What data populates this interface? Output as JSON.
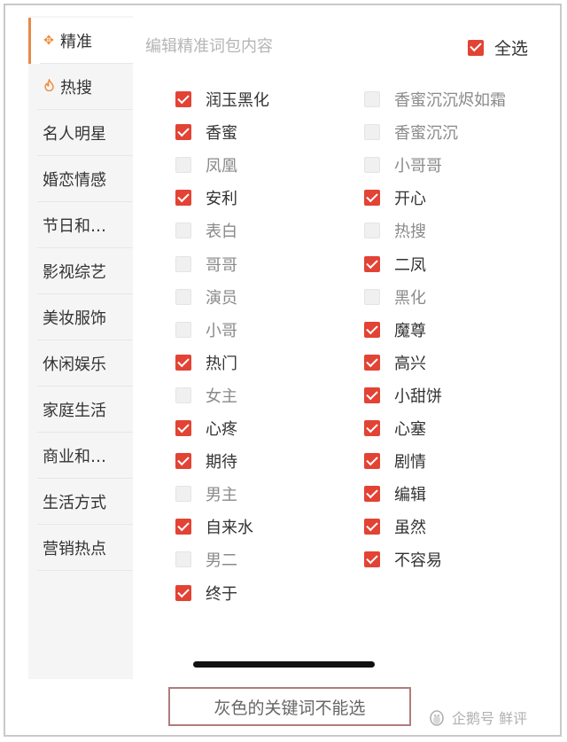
{
  "sidebar": {
    "items": [
      {
        "label": "精准",
        "icon": "target-icon",
        "active": true
      },
      {
        "label": "热搜",
        "icon": "flame-icon",
        "active": false
      },
      {
        "label": "名人明星",
        "active": false
      },
      {
        "label": "婚恋情感",
        "active": false
      },
      {
        "label": "节日和…",
        "active": false
      },
      {
        "label": "影视综艺",
        "active": false
      },
      {
        "label": "美妆服饰",
        "active": false
      },
      {
        "label": "休闲娱乐",
        "active": false
      },
      {
        "label": "家庭生活",
        "active": false
      },
      {
        "label": "商业和…",
        "active": false
      },
      {
        "label": "生活方式",
        "active": false
      },
      {
        "label": "营销热点",
        "active": false
      }
    ]
  },
  "header": {
    "label": "编辑精准词包内容",
    "select_all_label": "全选",
    "select_all_checked": true
  },
  "keywords": {
    "left": [
      {
        "label": "润玉黑化",
        "checked": true
      },
      {
        "label": "香蜜",
        "checked": true
      },
      {
        "label": "凤凰",
        "checked": false
      },
      {
        "label": "安利",
        "checked": true
      },
      {
        "label": "表白",
        "checked": false
      },
      {
        "label": "哥哥",
        "checked": false
      },
      {
        "label": "演员",
        "checked": false
      },
      {
        "label": "小哥",
        "checked": false
      },
      {
        "label": "热门",
        "checked": true
      },
      {
        "label": "女主",
        "checked": false
      },
      {
        "label": "心疼",
        "checked": true
      },
      {
        "label": "期待",
        "checked": true
      },
      {
        "label": "男主",
        "checked": false
      },
      {
        "label": "自来水",
        "checked": true
      },
      {
        "label": "男二",
        "checked": false
      },
      {
        "label": "终于",
        "checked": true
      }
    ],
    "right": [
      {
        "label": "香蜜沉沉烬如霜",
        "checked": false
      },
      {
        "label": "香蜜沉沉",
        "checked": false
      },
      {
        "label": "小哥哥",
        "checked": false
      },
      {
        "label": "开心",
        "checked": true
      },
      {
        "label": "热搜",
        "checked": false
      },
      {
        "label": "二凤",
        "checked": true
      },
      {
        "label": "黑化",
        "checked": false
      },
      {
        "label": "魔尊",
        "checked": true
      },
      {
        "label": "高兴",
        "checked": true
      },
      {
        "label": "小甜饼",
        "checked": true
      },
      {
        "label": "心塞",
        "checked": true
      },
      {
        "label": "剧情",
        "checked": true
      },
      {
        "label": "编辑",
        "checked": true
      },
      {
        "label": "虽然",
        "checked": true
      },
      {
        "label": "不容易",
        "checked": true
      }
    ]
  },
  "caption": "灰色的关键词不能选",
  "watermark": {
    "text": "企鹅号 鲜评",
    "icon": "penguin-icon"
  },
  "colors": {
    "checked": "#e24335",
    "accent": "#ee8a3a",
    "sidebar_bg": "#f5f5f5"
  }
}
